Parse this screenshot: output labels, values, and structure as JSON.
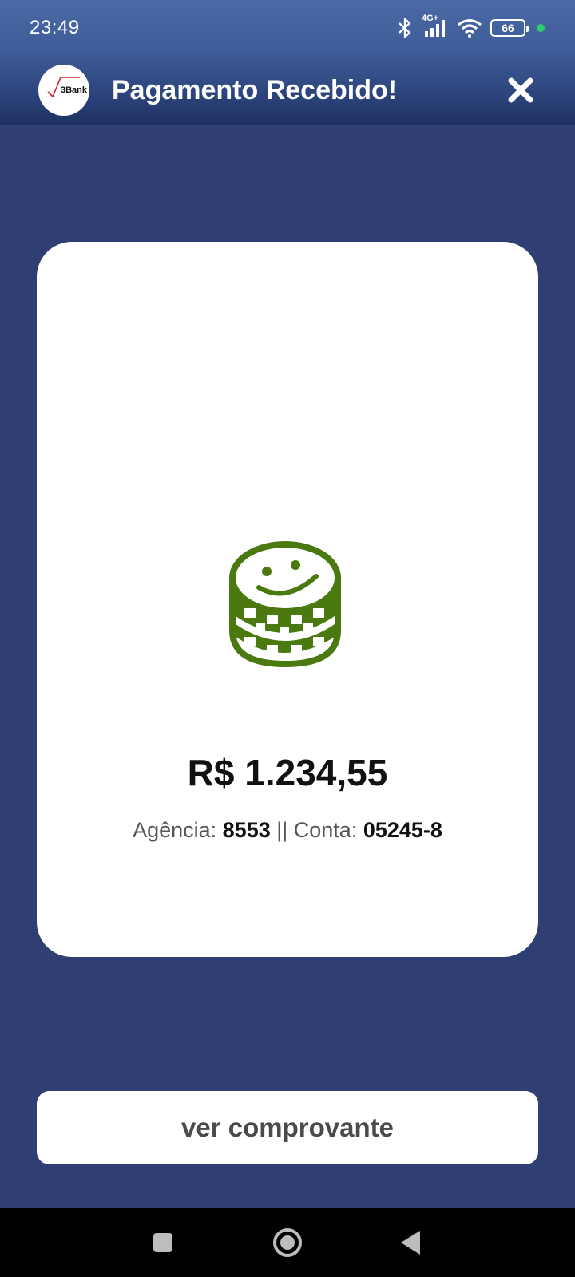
{
  "status_bar": {
    "time": "23:49",
    "network": "4G+",
    "battery": "66",
    "icons": [
      "bluetooth-icon",
      "signal-icon",
      "wifi-icon",
      "battery-icon"
    ]
  },
  "header": {
    "logo_text": "3Bank",
    "title": "Pagamento Recebido!",
    "close_icon": "close-icon"
  },
  "card": {
    "icon": "chips-stack-icon",
    "amount": "R$ 1.234,55",
    "agency_label": "Agência: ",
    "agency_value": "8553",
    "separator": " || ",
    "account_label": "Conta: ",
    "account_value": "05245-8"
  },
  "actions": {
    "receipt_button": "ver comprovante"
  },
  "colors": {
    "background": "#2f3f73",
    "card": "#ffffff",
    "icon_green": "#4a7a0f"
  }
}
